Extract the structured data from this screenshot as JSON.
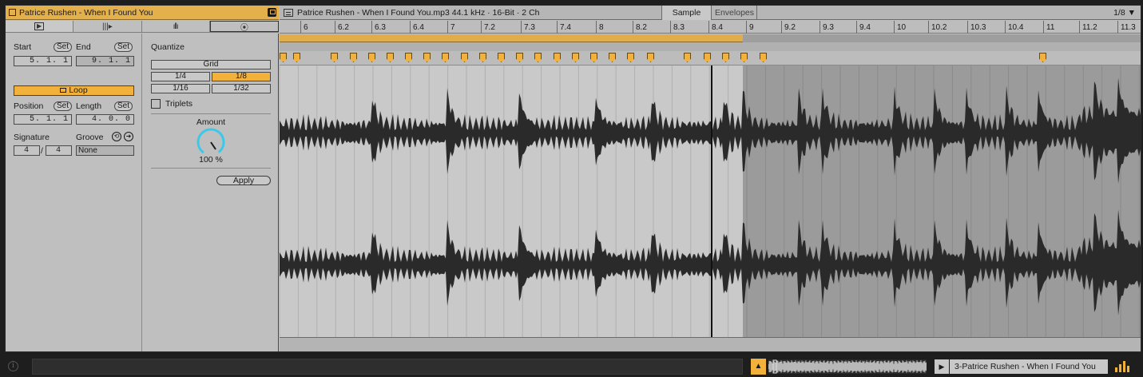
{
  "clip": {
    "title": "Patrice Rushen - When I Found You",
    "tabs": [
      "clip-tab",
      "warp-tab",
      "audio-tab",
      "quantize-tab"
    ],
    "start_label": "Start",
    "end_label": "End",
    "set_label": "Set",
    "start_value": "5.  1.  1",
    "end_value": "9.  1.  1",
    "loop_label": "Loop",
    "position_label": "Position",
    "length_label": "Length",
    "position_value": "5.  1.  1",
    "length_value": "4.  0.  0",
    "signature_label": "Signature",
    "groove_label": "Groove",
    "sig_num": "4",
    "sig_den": "4",
    "groove_value": "None"
  },
  "quantize": {
    "title": "Quantize",
    "grid_label": "Grid",
    "options": [
      "1/4",
      "1/8",
      "1/16",
      "1/32"
    ],
    "selected": "1/8",
    "triplets_label": "Triplets",
    "amount_label": "Amount",
    "amount_value": "100 %",
    "amount": 1.0,
    "apply_label": "Apply"
  },
  "sample": {
    "file_info": "Patrice Rushen - When I Found You.mp3  44.1 kHz · 16-Bit · 2 Ch",
    "sample_tab": "Sample",
    "envelopes_tab": "Envelopes",
    "grid_setting": "1/8 ▼",
    "ruler": [
      "6",
      "6.2",
      "6.3",
      "6.4",
      "7",
      "7.2",
      "7.3",
      "7.4",
      "8",
      "8.2",
      "8.3",
      "8.4",
      "9",
      "9.2",
      "9.3",
      "9.4",
      "10",
      "10.2",
      "10.3",
      "10.4",
      "11",
      "11.2",
      "11.3"
    ]
  },
  "status": {
    "warn_icon": "▲",
    "play_icon": "▶",
    "track_name": "3-Patrice Rushen - When I Found You",
    "info_icon": "i"
  },
  "colors": {
    "accent": "#f2b13b",
    "clip_header": "#e3b04b",
    "knob": "#3ec8e8"
  }
}
